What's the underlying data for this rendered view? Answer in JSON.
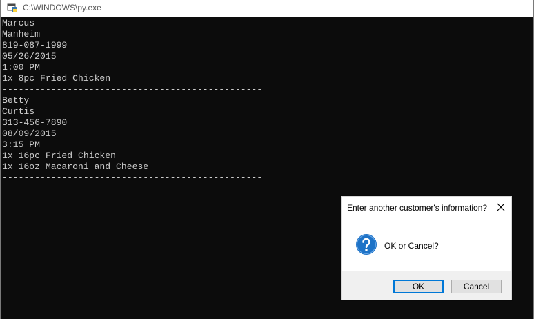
{
  "window": {
    "title": "C:\\WINDOWS\\py.exe",
    "icon": "python-app-icon"
  },
  "console": {
    "lines": [
      "Marcus",
      "Manheim",
      "819-087-1999",
      "05/26/2015",
      "1:00 PM",
      "1x 8pc Fried Chicken",
      "------------------------------------------------",
      "Betty",
      "Curtis",
      "313-456-7890",
      "08/09/2015",
      "3:15 PM",
      "1x 16pc Fried Chicken",
      "1x 16oz Macaroni and Cheese",
      "------------------------------------------------"
    ]
  },
  "dialog": {
    "title": "Enter another customer's information?",
    "message": "OK or Cancel?",
    "icon": "question-icon",
    "ok_label": "OK",
    "cancel_label": "Cancel"
  },
  "colors": {
    "console_bg": "#0c0c0c",
    "console_fg": "#cccccc",
    "accent": "#0078d7"
  }
}
